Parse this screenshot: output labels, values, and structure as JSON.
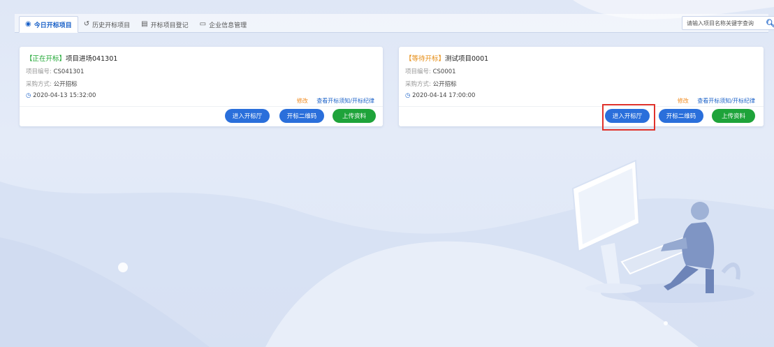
{
  "tabs": [
    {
      "label": "今日开标项目",
      "icon": "user-circle-icon",
      "glyph": "◉"
    },
    {
      "label": "历史开标项目",
      "icon": "history-icon",
      "glyph": "↺"
    },
    {
      "label": "开标项目登记",
      "icon": "document-icon",
      "glyph": "▤"
    },
    {
      "label": "企业信息管理",
      "icon": "monitor-icon",
      "glyph": "▭"
    }
  ],
  "search": {
    "placeholder": "请输入项目名称关键字查询",
    "icon": "search-icon"
  },
  "cards": [
    {
      "status": "【正在开标】",
      "name": "项目进场041301",
      "code_label": "项目编号:",
      "code": "CS041301",
      "method_label": "采购方式:",
      "method": "公开招标",
      "time": "2020-04-13 15:32:00",
      "edit_link": "修改",
      "view_link": "查看开标须知/开标纪律",
      "buttons": [
        "进入开标厅",
        "开标二维码",
        "上传资料"
      ]
    },
    {
      "status": "【等待开标】",
      "name": "测试项目0001",
      "code_label": "项目编号:",
      "code": "CS0001",
      "method_label": "采购方式:",
      "method": "公开招标",
      "time": "2020-04-14 17:00:00",
      "edit_link": "修改",
      "view_link": "查看开标须知/开标纪律",
      "buttons": [
        "进入开标厅",
        "开标二维码",
        "上传资料"
      ]
    }
  ],
  "colors": {
    "accent": "#1b62c8",
    "button_blue": "#2a6fdb",
    "button_green": "#1ea33a",
    "status_live": "#1aa52f",
    "status_wait": "#e58a0e",
    "edit_link": "#f08a1e",
    "highlight": "#e0322b"
  }
}
